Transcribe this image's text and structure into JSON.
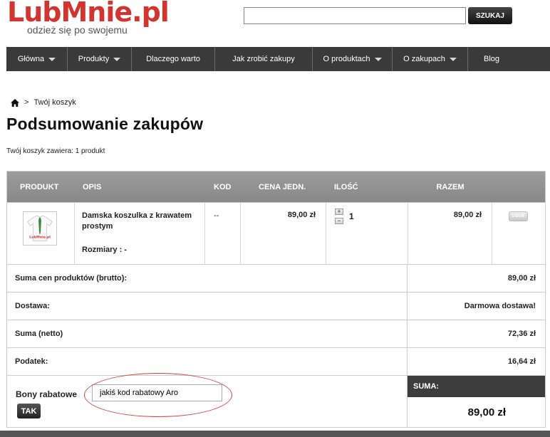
{
  "header": {
    "logo_text": "LubMnie.pl",
    "logo_tagline": "odzież się po swojemu",
    "search_placeholder": "",
    "search_button": "SZUKAJ"
  },
  "nav": {
    "items": [
      {
        "label": "Główna",
        "dropdown": true
      },
      {
        "label": "Produkty",
        "dropdown": true
      },
      {
        "label": "Dlaczego warto",
        "dropdown": false
      },
      {
        "label": "Jak zrobić zakupy",
        "dropdown": false
      },
      {
        "label": "O produktach",
        "dropdown": true
      },
      {
        "label": "O zakupach",
        "dropdown": true
      },
      {
        "label": "Blog",
        "dropdown": false
      }
    ]
  },
  "breadcrumb": {
    "separator": ">",
    "current": "Twój koszyk"
  },
  "page_title": "Podsumowanie zakupów",
  "cart_count": "Twój koszyk zawiera: 1 produkt",
  "table": {
    "headers": {
      "product": "PRODUKT",
      "description": "OPIS",
      "code": "KOD",
      "unit_price": "CENA JEDN.",
      "quantity": "ILOŚĆ",
      "total": "RAZEM"
    },
    "items": [
      {
        "thumb_text": "LubMnie.pl",
        "name": "Damska koszulka z krawatem prostym",
        "sizes": "Rozmiary : -",
        "code": "--",
        "unit_price": "89,00 zł",
        "quantity": "1",
        "total": "89,00 zł",
        "remove_label": "USUŃ"
      }
    ]
  },
  "summary": [
    {
      "label": "Suma cen produktów (brutto):",
      "value": "89,00 zł"
    },
    {
      "label": "Dostawa:",
      "value": "Darmowa dostawa!"
    },
    {
      "label": "Suma (netto)",
      "value": "72,36 zł"
    },
    {
      "label": "Podatek:",
      "value": "16,64 zł"
    }
  ],
  "voucher": {
    "label": "Bony rabatowe",
    "value": "jakiś kod rabatowy Aro",
    "button": "TAK"
  },
  "grand_total": {
    "label": "SUMA:",
    "value": "89,00 zł"
  },
  "colors": {
    "brand_red": "#d2342f",
    "nav_bg": "#3a3a3a",
    "table_header": "#929292",
    "highlight_ellipse": "#d84545"
  }
}
